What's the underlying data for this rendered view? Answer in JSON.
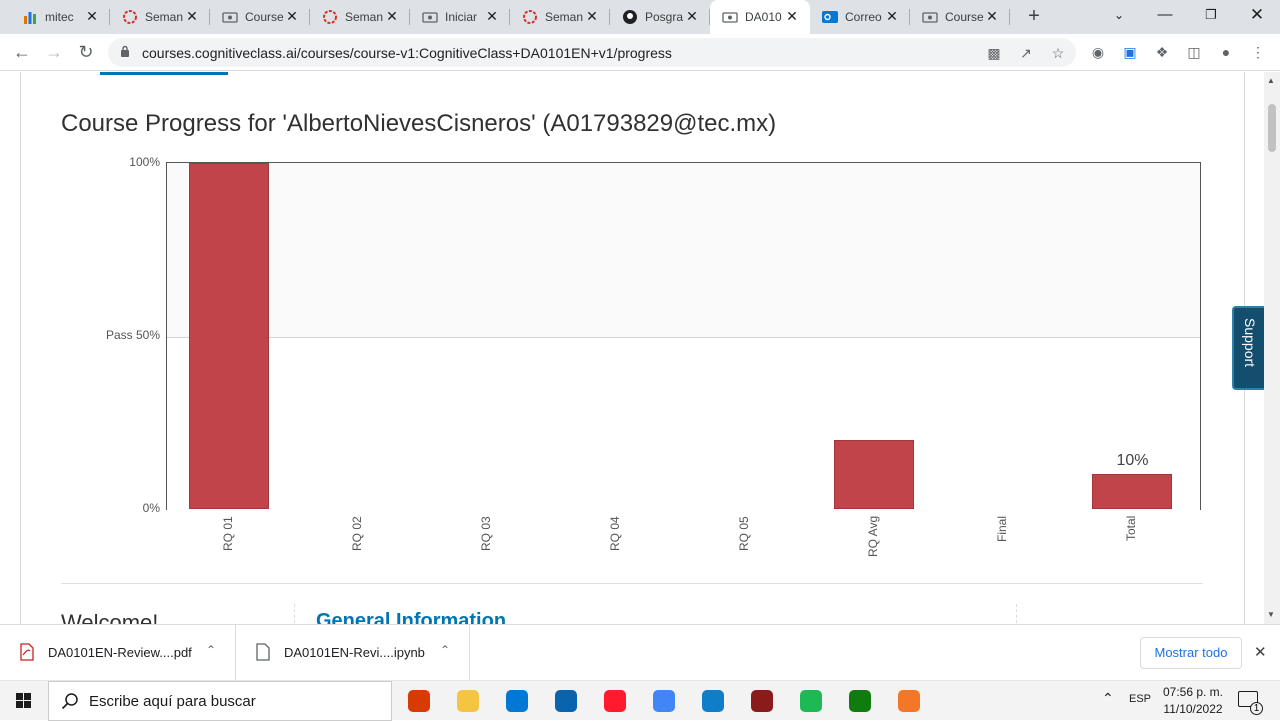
{
  "tabs": [
    {
      "title": "mitec",
      "icon": "bar-chart-icon"
    },
    {
      "title": "Seman",
      "icon": "ring-icon"
    },
    {
      "title": "Course",
      "icon": "course-icon"
    },
    {
      "title": "Seman",
      "icon": "ring-icon"
    },
    {
      "title": "Iniciar",
      "icon": "course-icon"
    },
    {
      "title": "Seman",
      "icon": "ring-icon"
    },
    {
      "title": "Posgra",
      "icon": "github-icon"
    },
    {
      "title": "DA010",
      "icon": "course-icon"
    },
    {
      "title": "Correo",
      "icon": "outlook-icon"
    },
    {
      "title": "Course",
      "icon": "course-icon"
    }
  ],
  "active_tab_index": 7,
  "address": {
    "url": "courses.cognitiveclass.ai/courses/course-v1:CognitiveClass+DA0101EN+v1/progress"
  },
  "page": {
    "title": "Course Progress for 'AlbertoNievesCisneros' (A01793829@tec.mx)",
    "welcome": "Welcome!",
    "general_info": "General Information",
    "support": "Support"
  },
  "chart_data": {
    "type": "bar",
    "categories": [
      "RQ 01",
      "RQ 02",
      "RQ 03",
      "RQ 04",
      "RQ 05",
      "RQ Avg",
      "Final",
      "Total"
    ],
    "values": [
      100,
      0,
      0,
      0,
      0,
      20,
      0,
      10
    ],
    "y_ticks": [
      {
        "value": 100,
        "label": "100%"
      },
      {
        "value": 50,
        "label": "Pass 50%"
      },
      {
        "value": 0,
        "label": "0%"
      }
    ],
    "data_labels": [
      {
        "category": "Total",
        "label": "10%"
      }
    ],
    "ylim": [
      0,
      100
    ],
    "bar_color": "#c1444a"
  },
  "downloads": [
    {
      "name": "DA0101EN-Review....pdf",
      "icon": "pdf-icon"
    },
    {
      "name": "DA0101EN-Revi....ipynb",
      "icon": "file-icon"
    }
  ],
  "download_bar": {
    "show_all": "Mostrar todo"
  },
  "taskbar": {
    "search_placeholder": "Escribe aquí para buscar",
    "language": "ESP",
    "time": "07:56 p. m.",
    "date": "11/10/2022",
    "notification_count": "1",
    "apps": [
      {
        "name": "office-icon",
        "color": "#d83b01"
      },
      {
        "name": "file-explorer-icon",
        "color": "#f4c542"
      },
      {
        "name": "store-icon",
        "color": "#0078d4"
      },
      {
        "name": "mail-icon",
        "color": "#0a64ad"
      },
      {
        "name": "opera-icon",
        "color": "#ff1b2d"
      },
      {
        "name": "chrome-icon",
        "color": "#4285f4"
      },
      {
        "name": "edge-icon",
        "color": "#0f7ec9"
      },
      {
        "name": "game-icon",
        "color": "#8b1a1a"
      },
      {
        "name": "spotify-icon",
        "color": "#1db954"
      },
      {
        "name": "xbox-icon",
        "color": "#107c10"
      },
      {
        "name": "jupyter-icon",
        "color": "#f37726"
      }
    ]
  }
}
